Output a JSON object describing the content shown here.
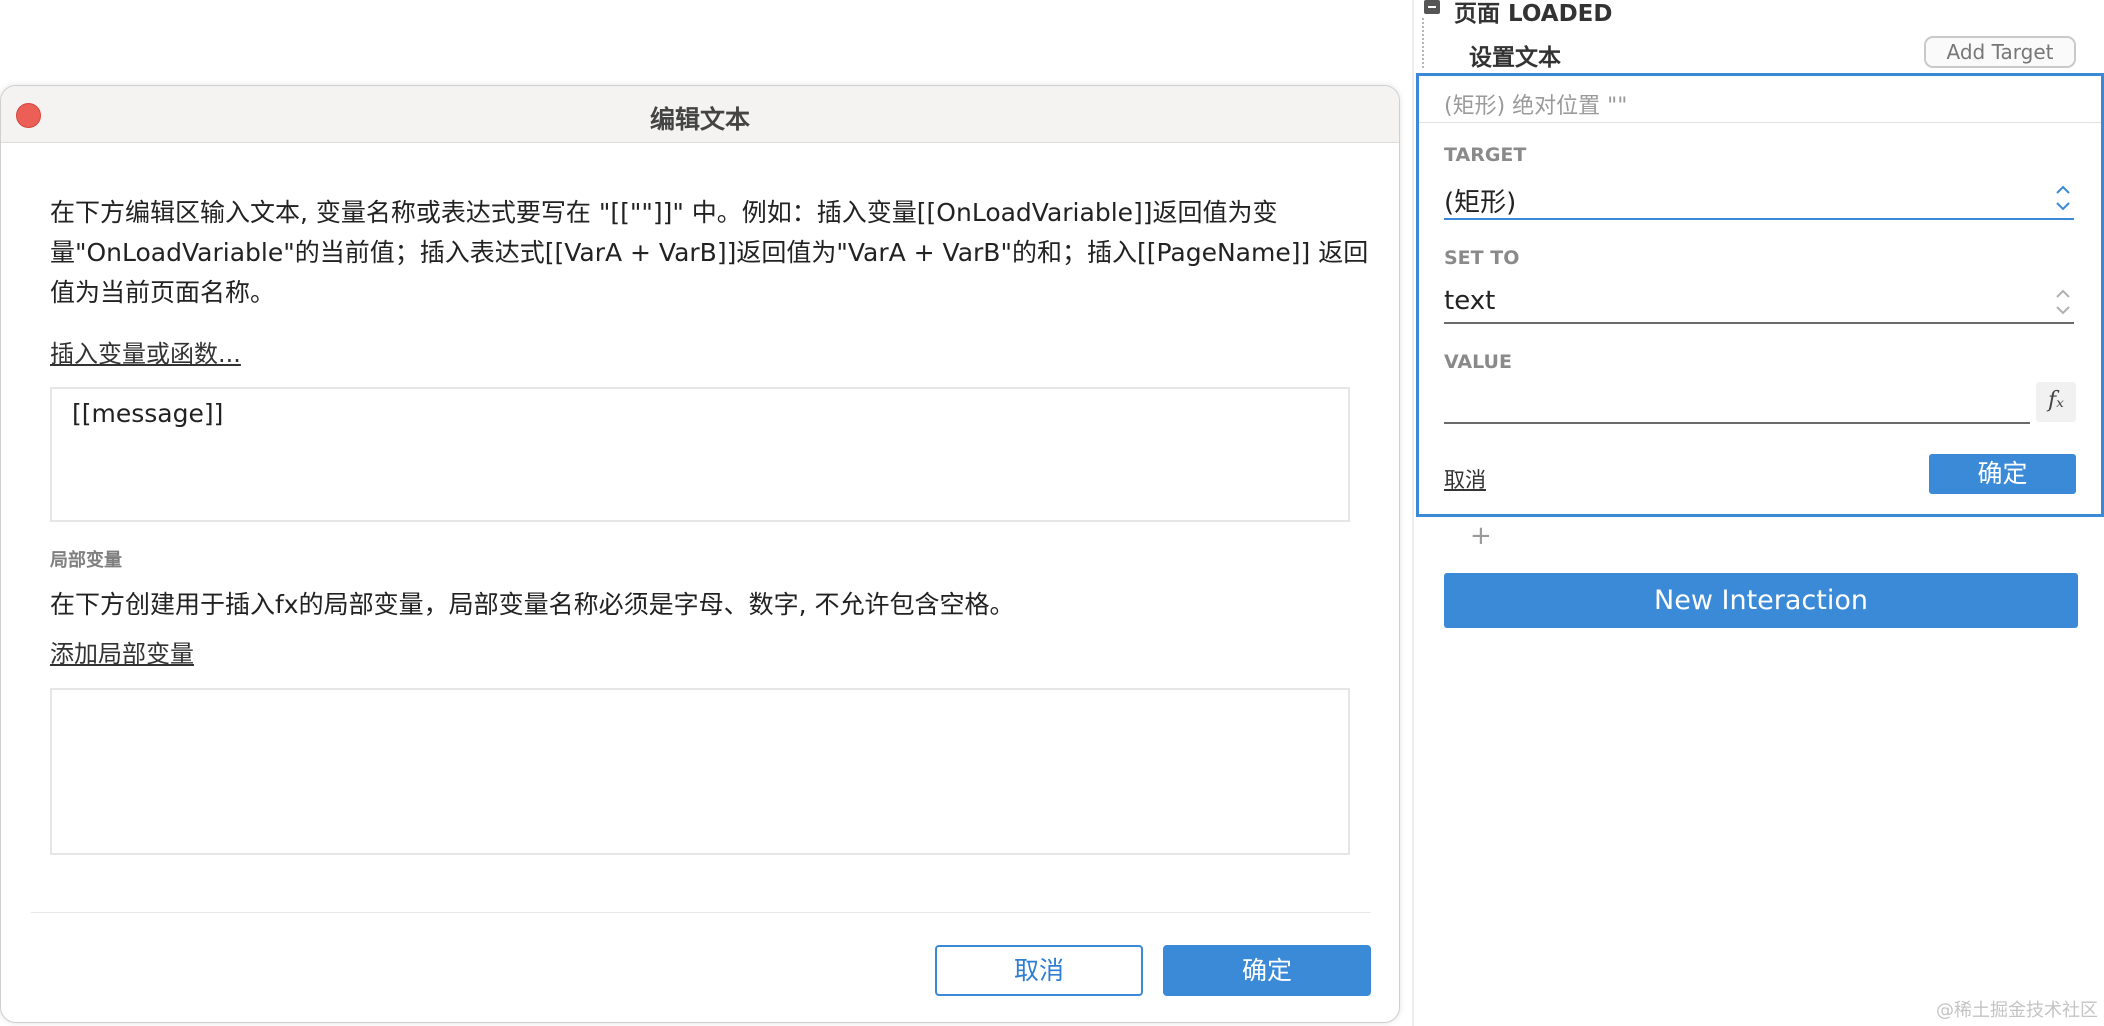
{
  "dialog": {
    "title": "编辑文本",
    "instructions": "在下方编辑区输入文本, 变量名称或表达式要写在 \"[[\"\"]]\" 中。例如：插入变量[[OnLoadVariable]]返回值为变量\"OnLoadVariable\"的当前值；插入表达式[[VarA + VarB]]返回值为\"VarA + VarB\"的和；插入[[PageName]] 返回值为当前页面名称。",
    "insert_link": "插入变量或函数...",
    "text_value": "[[message]]",
    "local_section_label": "局部变量",
    "local_description": "在下方创建用于插入fx的局部变量，局部变量名称必须是字母、数字, 不允许包含空格。",
    "add_local_link": "添加局部变量",
    "locals": [],
    "cancel_label": "取消",
    "ok_label": "确定"
  },
  "panel": {
    "event_title": "页面 LOADED",
    "action_title": "设置文本",
    "add_target_label": "Add Target",
    "card": {
      "header": "(矩形) 绝对位置 \"\"",
      "target_label": "TARGET",
      "target_value": "(矩形)",
      "setto_label": "SET TO",
      "setto_value": "text",
      "value_label": "VALUE",
      "value": "",
      "fx_icon": "fx-icon",
      "cancel_label": "取消",
      "ok_label": "确定"
    },
    "add_action_icon": "plus-icon",
    "new_interaction_label": "New Interaction"
  },
  "watermark": "@稀土掘金技术社区",
  "colors": {
    "accent": "#3b8ad8",
    "close": "#ec5f57"
  }
}
